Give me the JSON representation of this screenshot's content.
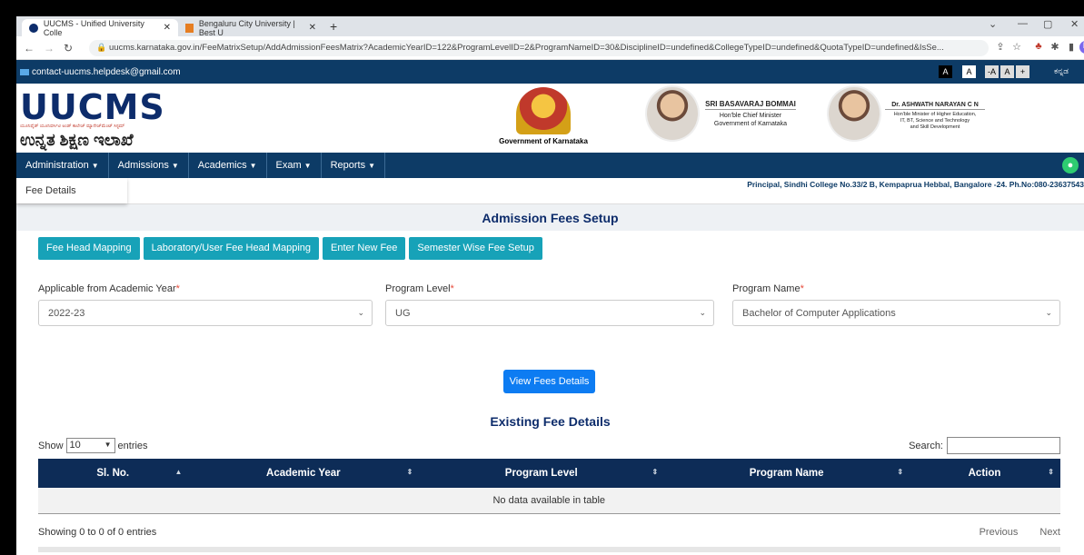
{
  "browser": {
    "tabs": [
      {
        "title": "UUCMS - Unified University Colle",
        "active": true
      },
      {
        "title": "Bengaluru City University | Best U",
        "active": false
      }
    ],
    "url": "uucms.karnataka.gov.in/FeeMatrixSetup/AddAdmissionFeesMatrix?AcademicYearID=122&ProgramLevelID=2&ProgramNameID=30&DisciplineID=undefined&CollegeTypeID=undefined&QuotaTypeID=undefined&IsSe..."
  },
  "site": {
    "contact": "contact-uucms.helpdesk@gmail.com",
    "font_controls": [
      "A",
      "A",
      "-A",
      "A",
      "+"
    ],
    "language": "ಕನ್ನಡ",
    "logo_text": "UUCMS",
    "logo_tagline": "ಯೂನಿಫೈಡ್ ಯೂನಿವರ್ಸಿಟಿ ಅಂಡ್ ಕಾಲೇಜ್ ಮ್ಯಾನೇಜ್‌ಮೆಂಟ್ ಸಿಸ್ಟಮ್",
    "logo_kannada": "ಉನ್ನತ ಶಿಕ್ಷಣ ಇಲಾಖೆ",
    "govt_caption": "Government of Karnataka",
    "cm": {
      "name": "SRI BASAVARAJ BOMMAI",
      "line1": "Hon'ble Chief Minister",
      "line2": "Government of Karnataka"
    },
    "minister": {
      "name": "Dr. ASHWATH NARAYAN C N",
      "line1": "Hon'ble Minister of Higher Education,",
      "line2": "IT, BT, Science and Technology",
      "line3": "and Skill Development"
    }
  },
  "nav": {
    "items": [
      "Administration",
      "Admissions",
      "Academics",
      "Exam",
      "Reports"
    ],
    "dropdown_item": "Fee Details",
    "principal": "Principal, Sindhi College No.33/2 B, Kempaprua Hebbal, Bangalore -24. Ph.No:080-23637543"
  },
  "page": {
    "title": "Admission Fees Setup",
    "buttons": [
      "Fee Head Mapping",
      "Laboratory/User Fee Head Mapping",
      "Enter New Fee",
      "Semester Wise Fee Setup"
    ],
    "fields": {
      "academic_year": {
        "label": "Applicable from Academic Year",
        "value": "2022-23"
      },
      "program_level": {
        "label": "Program Level",
        "value": "UG"
      },
      "program_name": {
        "label": "Program Name",
        "value": "Bachelor of Computer Applications"
      }
    },
    "required_mark": "*",
    "view_button": "View Fees Details",
    "existing_title": "Existing Fee Details"
  },
  "table": {
    "show_label": "Show",
    "page_size": "10",
    "entries_label": "entries",
    "search_label": "Search:",
    "columns": [
      "Sl. No.",
      "Academic Year",
      "Program Level",
      "Program Name",
      "Action"
    ],
    "empty_text": "No data available in table",
    "info": "Showing 0 to 0 of 0 entries",
    "prev": "Previous",
    "next": "Next"
  },
  "colors": {
    "navy": "#0d3b66",
    "teal": "#17a2b8",
    "blue": "#0d7cf2"
  }
}
